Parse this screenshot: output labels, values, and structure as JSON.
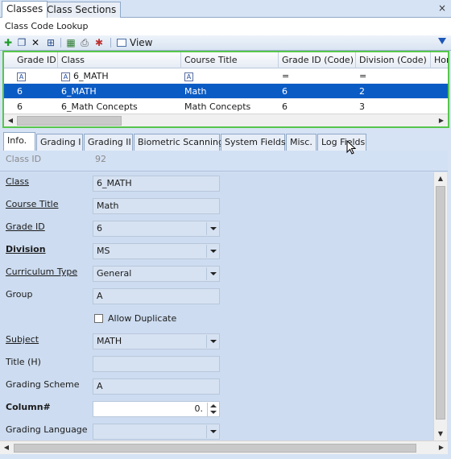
{
  "top_tabs": [
    {
      "label": "Classes",
      "active": true
    },
    {
      "label": "Class Sections",
      "active": false
    }
  ],
  "close_glyph": "×",
  "lookup": {
    "title": "Class Code Lookup",
    "view_label": "View"
  },
  "grid": {
    "columns": [
      "Grade ID",
      "Class",
      "Course Title",
      "Grade ID (Code)",
      "Division (Code)",
      "Hom"
    ],
    "filter_row": {
      "grade_id": "A",
      "class": "6_MATH",
      "course_title": "A",
      "grade_code": "=",
      "division_code": "="
    },
    "rows": [
      {
        "grade_id": "6",
        "class": "6_MATH",
        "course_title": "Math",
        "grade_code": "6",
        "division_code": "2",
        "selected": true
      },
      {
        "grade_id": "6",
        "class": "6_Math Concepts",
        "course_title": "Math Concepts",
        "grade_code": "6",
        "division_code": "3",
        "selected": false
      }
    ]
  },
  "detail_tabs": [
    "Info.",
    "Grading I",
    "Grading II",
    "Biometric Scanning",
    "System Fields",
    "Misc.",
    "Log Fields"
  ],
  "active_detail_tab": "Info.",
  "class_id": {
    "label": "Class ID",
    "value": "92"
  },
  "form": {
    "class": {
      "label": "Class",
      "value": "6_MATH"
    },
    "course_title": {
      "label": "Course Title",
      "value": "Math"
    },
    "grade_id": {
      "label": "Grade ID",
      "value": "6"
    },
    "division": {
      "label": "Division",
      "value": "MS"
    },
    "curriculum_type": {
      "label": "Curriculum Type",
      "value": "General"
    },
    "group": {
      "label": "Group",
      "value": "A"
    },
    "allow_duplicate": {
      "label": "Allow Duplicate",
      "checked": false
    },
    "subject": {
      "label": "Subject",
      "value": "MATH"
    },
    "title_h": {
      "label": "Title (H)",
      "value": ""
    },
    "grading_scheme": {
      "label": "Grading Scheme",
      "value": "A"
    },
    "column_num": {
      "label": "Column#",
      "value": "0."
    },
    "grading_language": {
      "label": "Grading Language",
      "value": ""
    }
  },
  "colors": {
    "accent_selected": "#0b5bc4",
    "grid_border": "#56c64b",
    "panel_bg": "#cddcf0"
  }
}
